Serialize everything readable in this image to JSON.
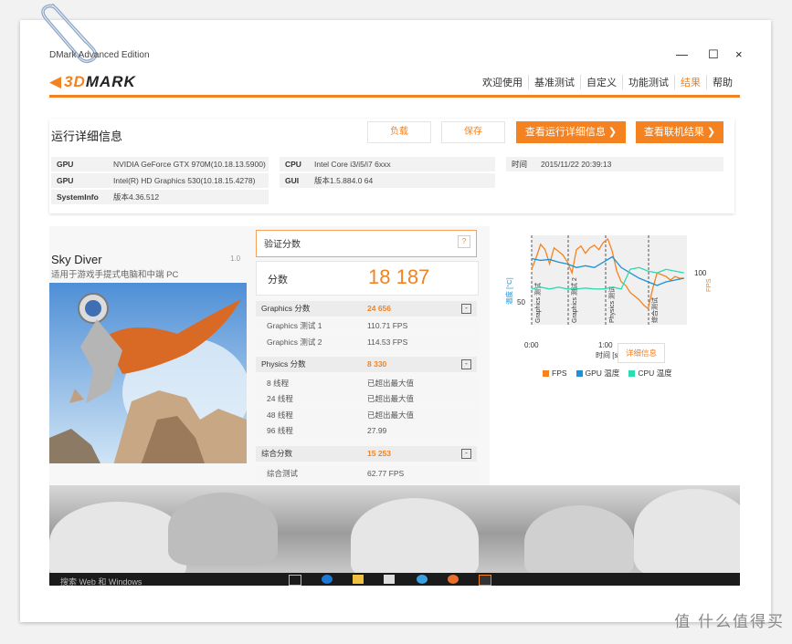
{
  "window": {
    "title": "DMark Advanced Edition",
    "controls": [
      "—",
      "☐",
      "×"
    ]
  },
  "app": {
    "logo_mark": "3D",
    "logo_text": "MARK",
    "nav": [
      "欢迎使用",
      "基准测试",
      "自定义",
      "功能测试",
      "结果",
      "帮助"
    ],
    "active_nav": "结果"
  },
  "details": {
    "title": "运行详细信息",
    "buttons": {
      "load": "负载",
      "save": "保存",
      "view_details": "查看运行详细信息",
      "view_online": "查看联机结果"
    },
    "left_rows": [
      {
        "key": "GPU",
        "value": "NVIDIA GeForce GTX 970M(10.18.13.5900)"
      },
      {
        "key": "GPU",
        "value": "Intel(R) HD Graphics 530(10.18.15.4278)"
      },
      {
        "key": "SystemInfo",
        "value": "版本4.36.512"
      }
    ],
    "mid_rows": [
      {
        "key": "CPU",
        "value": "Intel Core i3/i5/i7 6xxx"
      },
      {
        "key": "GUI",
        "value": "版本1.5.884.0 64"
      }
    ],
    "time_label": "时间",
    "time_value": "2015/11/22 20:39:13"
  },
  "test": {
    "name": "Sky Diver",
    "subtitle": "适用于游戏手提式电脑和中端 PC",
    "version": "1.0"
  },
  "scores": {
    "verify_label": "验证分数",
    "help": "?",
    "total_label": "分数",
    "total_value": "18 187",
    "sections": [
      {
        "name": "Graphics 分数",
        "value": "24 656",
        "toggle": "-",
        "items": [
          {
            "name": "Graphics 测试 1",
            "value": "110.71 FPS"
          },
          {
            "name": "Graphics 测试 2",
            "value": "114.53 FPS"
          }
        ]
      },
      {
        "name": "Physics 分数",
        "value": "8 330",
        "toggle": "-",
        "items": [
          {
            "name": "8 线程",
            "value": "已超出最大值"
          },
          {
            "name": "24 线程",
            "value": "已超出最大值"
          },
          {
            "name": "48 线程",
            "value": "已超出最大值"
          },
          {
            "name": "96 线程",
            "value": "27.99"
          }
        ]
      },
      {
        "name": "综合分数",
        "value": "15 253",
        "toggle": "-",
        "items": [
          {
            "name": "综合测试",
            "value": "62.77 FPS"
          }
        ]
      }
    ]
  },
  "chart_data": {
    "type": "line",
    "xlabel": "时间 [s]",
    "ylabel_left": "温度 [°C]",
    "ylabel_right": "FPS",
    "x_ticks": [
      "0:00",
      "1:00"
    ],
    "y_left_ticks": [
      50
    ],
    "y_right_ticks": [
      100
    ],
    "segments": [
      "Graphics 测试",
      "Graphics 测试 2",
      "Physics 测试",
      "综合测试"
    ],
    "series": [
      {
        "name": "FPS",
        "color": "#f58220",
        "x": [
          0,
          3,
          6,
          9,
          12,
          15,
          18,
          21,
          24,
          27,
          30,
          33,
          36,
          39,
          42,
          45,
          48,
          51,
          54,
          57,
          60,
          63,
          66,
          69,
          72,
          75,
          78,
          81,
          84,
          87,
          90,
          93,
          96,
          99,
          102
        ],
        "values": [
          62,
          75,
          90,
          84,
          68,
          86,
          82,
          78,
          70,
          58,
          84,
          88,
          80,
          86,
          89,
          84,
          92,
          96,
          82,
          60,
          48,
          44,
          36,
          32,
          28,
          22,
          18,
          40,
          58,
          56,
          54,
          50,
          54,
          52,
          52
        ]
      },
      {
        "name": "GPU 温度",
        "color": "#1e90d6",
        "x": [
          0,
          6,
          12,
          18,
          24,
          30,
          36,
          42,
          48,
          54,
          60,
          66,
          72,
          78,
          84,
          90,
          96,
          102
        ],
        "values": [
          74,
          72,
          73,
          70,
          68,
          64,
          66,
          64,
          70,
          76,
          64,
          58,
          52,
          48,
          44,
          48,
          50,
          52
        ]
      },
      {
        "name": "CPU 温度",
        "color": "#2ddbb3",
        "x": [
          0,
          6,
          12,
          18,
          24,
          30,
          36,
          42,
          48,
          54,
          60,
          66,
          72,
          78,
          84,
          90,
          96,
          102
        ],
        "values": [
          40,
          42,
          40,
          42,
          40,
          40,
          41,
          40,
          40,
          42,
          40,
          62,
          64,
          60,
          58,
          62,
          60,
          58
        ]
      }
    ],
    "detail_button": "详细信息"
  },
  "taskbar": {
    "search": "搜索 Web 和 Windows"
  },
  "watermark": "值 什么值得买"
}
